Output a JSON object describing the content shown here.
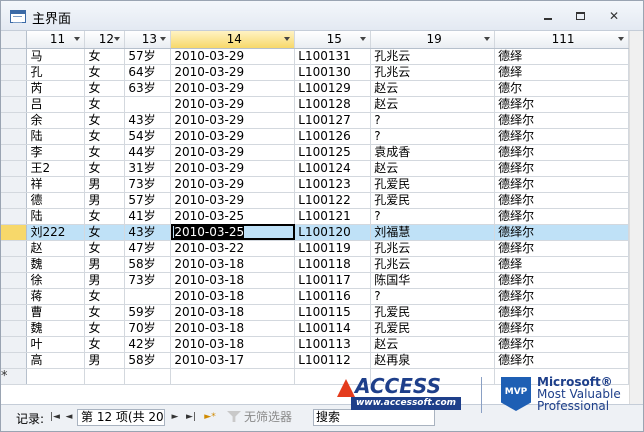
{
  "window": {
    "title": "主界面"
  },
  "columns": [
    "11",
    "12",
    "13",
    "14",
    "15",
    "19",
    "111"
  ],
  "rows": [
    [
      "马",
      "女",
      "57岁",
      "2010-03-29",
      "L100131",
      "孔兆云",
      "德绎"
    ],
    [
      "孔",
      "女",
      "64岁",
      "2010-03-29",
      "L100130",
      "孔兆云",
      "德绎"
    ],
    [
      "芮",
      "女",
      "63岁",
      "2010-03-29",
      "L100129",
      "赵云",
      "德尔"
    ],
    [
      "吕",
      "女",
      "",
      "2010-03-29",
      "L100128",
      "赵云",
      "德绎尔"
    ],
    [
      "余",
      "女",
      "43岁",
      "2010-03-29",
      "L100127",
      "?",
      "德绎尔"
    ],
    [
      "陆",
      "女",
      "54岁",
      "2010-03-29",
      "L100126",
      "?",
      "德绎尔"
    ],
    [
      "李",
      "女",
      "44岁",
      "2010-03-29",
      "L100125",
      "袁成香",
      "德绎尔"
    ],
    [
      "王2",
      "女",
      "31岁",
      "2010-03-29",
      "L100124",
      "赵云",
      "德绎尔"
    ],
    [
      "祥",
      "男",
      "73岁",
      "2010-03-29",
      "L100123",
      "孔爱民",
      "德绎尔"
    ],
    [
      "德",
      "男",
      "57岁",
      "2010-03-29",
      "L100122",
      "孔爱民",
      "德绎尔"
    ],
    [
      "陆",
      "女",
      "41岁",
      "2010-03-25",
      "L100121",
      "?",
      "德绎尔"
    ],
    [
      "刘222",
      "女",
      "43岁",
      "2010-03-25",
      "L100120",
      "刘福慧",
      "德绎尔"
    ],
    [
      "赵",
      "女",
      "47岁",
      "2010-03-22",
      "L100119",
      "孔兆云",
      "德绎尔"
    ],
    [
      "魏",
      "男",
      "58岁",
      "2010-03-18",
      "L100118",
      "孔兆云",
      "德绎"
    ],
    [
      "徐",
      "男",
      "73岁",
      "2010-03-18",
      "L100117",
      "陈国华",
      "德绎尔"
    ],
    [
      "蒋",
      "女",
      "",
      "2010-03-18",
      "L100116",
      "?",
      "德绎尔"
    ],
    [
      "曹",
      "女",
      "59岁",
      "2010-03-18",
      "L100115",
      "孔爱民",
      "德绎尔"
    ],
    [
      "魏",
      "女",
      "70岁",
      "2010-03-18",
      "L100114",
      "孔爱民",
      "德绎尔"
    ],
    [
      "叶",
      "女",
      "42岁",
      "2010-03-18",
      "L100113",
      "赵云",
      "德绎尔"
    ],
    [
      "高",
      "男",
      "58岁",
      "2010-03-17",
      "L100112",
      "赵再泉",
      "德绎尔"
    ]
  ],
  "current_row_index": 11,
  "new_row_marker": "*",
  "nav": {
    "label": "记录:",
    "first": "|◄",
    "prev": "◄",
    "record_text": "第 12 项(共 20 I",
    "next": "►",
    "last": "►|",
    "new": "►*",
    "filter_label": "无筛选器",
    "search_placeholder": "搜索"
  },
  "watermark": {
    "access_text": "ACCESS",
    "access_url": "www.accessoft.com",
    "mvp_badge": "MVP",
    "ms_line1": "Microsoft®",
    "ms_line2": "Most Valuable",
    "ms_line3": "Professional"
  },
  "colors": {
    "selected_row": "#bfe1f7",
    "selected_header": "#f7d86a",
    "grid_line": "#d3d8de"
  }
}
